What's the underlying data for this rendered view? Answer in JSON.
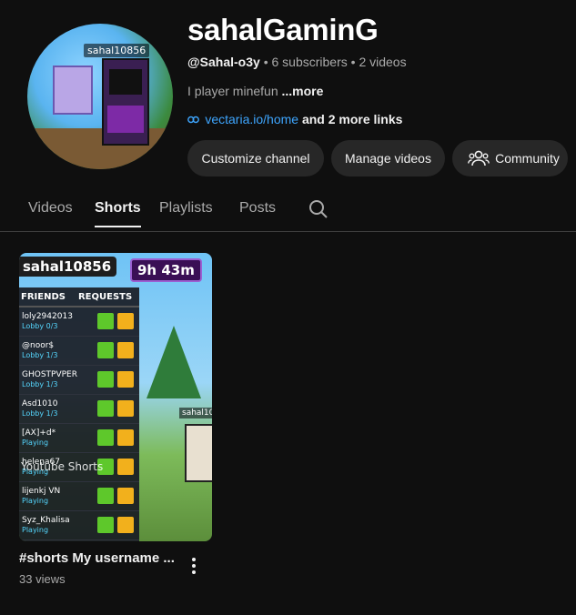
{
  "channel": {
    "name": "sahalGaminG",
    "handle": "@Sahal-o3y",
    "subscribers": "6 subscribers",
    "videos": "2 videos",
    "separator": "•",
    "description": "I player minefun",
    "description_more": "...more",
    "link_text": "vectaria.io/home",
    "more_links": "and 2 more links",
    "avatar_tag": "sahal10856"
  },
  "buttons": {
    "customize": "Customize channel",
    "manage": "Manage videos",
    "community": "Community"
  },
  "tabs": [
    {
      "label": "Videos",
      "active": false
    },
    {
      "label": "Shorts",
      "active": true
    },
    {
      "label": "Playlists",
      "active": false
    },
    {
      "label": "Posts",
      "active": false
    }
  ],
  "short": {
    "title": "#shorts My username ...",
    "views": "33 views",
    "thumb": {
      "name_tag": "sahal10856",
      "time_tag": "9h 43m",
      "header_friends": "FRIENDS",
      "header_requests": "REQUESTS",
      "player_tag": "sahal10",
      "watermark": "Youtube Shorts",
      "rows": [
        {
          "name": "loly2942013",
          "status": "Lobby 0/3"
        },
        {
          "name": "@noor$",
          "status": "Lobby 1/3"
        },
        {
          "name": "GHOSTPVPER",
          "status": "Lobby 1/3"
        },
        {
          "name": "Asd1010",
          "status": "Lobby 1/3"
        },
        {
          "name": "[AX]+d*",
          "status": "Playing"
        },
        {
          "name": "helena67",
          "status": "Playing"
        },
        {
          "name": "lijenkj VN",
          "status": "Playing"
        },
        {
          "name": "Syz_Khalisa",
          "status": "Playing"
        }
      ]
    }
  },
  "colors": {
    "background": "#0f0f0f",
    "button_bg": "#272727",
    "link": "#3ea6ff",
    "secondary_text": "#aaaaaa"
  }
}
